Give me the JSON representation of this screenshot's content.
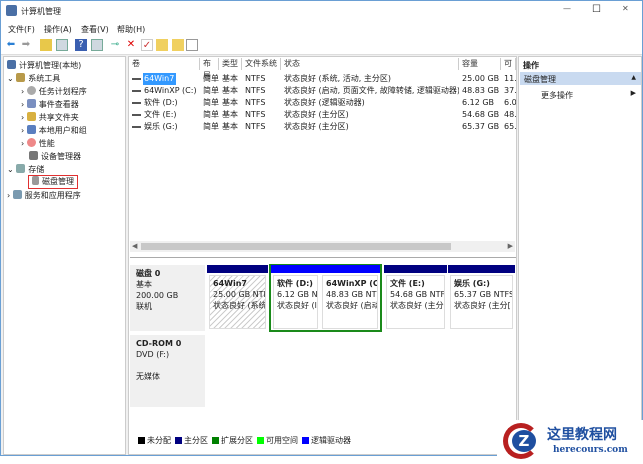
{
  "window": {
    "title": "计算机管理",
    "min": "—",
    "max": "☐",
    "close": "✕"
  },
  "menu": [
    "文件(F)",
    "操作(A)",
    "查看(V)",
    "帮助(H)"
  ],
  "tree": {
    "root": "计算机管理(本地)",
    "system_tools": "系统工具",
    "task_scheduler": "任务计划程序",
    "event_viewer": "事件查看器",
    "shared_folders": "共享文件夹",
    "local_users": "本地用户和组",
    "performance": "性能",
    "device_manager": "设备管理器",
    "storage": "存储",
    "disk_management": "磁盘管理",
    "services": "服务和应用程序"
  },
  "volumes": {
    "headers": [
      "卷",
      "布局",
      "类型",
      "文件系统",
      "状态",
      "容量",
      "可用"
    ],
    "rows": [
      {
        "name": "64Win7",
        "layout": "简单",
        "type": "基本",
        "fs": "NTFS",
        "status": "状态良好 (系统, 活动, 主分区)",
        "capacity": "25.00 GB",
        "free": "11."
      },
      {
        "name": "64WinXP  (C:)",
        "layout": "简单",
        "type": "基本",
        "fs": "NTFS",
        "status": "状态良好 (启动, 页面文件, 故障转储, 逻辑驱动器)",
        "capacity": "48.83 GB",
        "free": "37."
      },
      {
        "name": "软件 (D:)",
        "layout": "简单",
        "type": "基本",
        "fs": "NTFS",
        "status": "状态良好 (逻辑驱动器)",
        "capacity": "6.12 GB",
        "free": "6.0"
      },
      {
        "name": "文件 (E:)",
        "layout": "简单",
        "type": "基本",
        "fs": "NTFS",
        "status": "状态良好 (主分区)",
        "capacity": "54.68 GB",
        "free": "48."
      },
      {
        "name": "娱乐 (G:)",
        "layout": "简单",
        "type": "基本",
        "fs": "NTFS",
        "status": "状态良好 (主分区)",
        "capacity": "65.37 GB",
        "free": "65."
      }
    ]
  },
  "disk0": {
    "name": "磁盘 0",
    "type": "基本",
    "size": "200.00 GB",
    "state": "联机",
    "partitions": [
      {
        "name": "64Win7",
        "size": "25.00 GB NTF",
        "status": "状态良好 (系统"
      },
      {
        "name": "软件  (D:)",
        "size": "6.12 GB N",
        "status": "状态良好 (l"
      },
      {
        "name": "64WinXP   (C",
        "size": "48.83 GB NTF",
        "status": "状态良好 (启动"
      },
      {
        "name": "文件  (E:)",
        "size": "54.68 GB NTFS",
        "status": "状态良好 (主分["
      },
      {
        "name": "娱乐  (G:)",
        "size": "65.37 GB NTFS",
        "status": "状态良好 (主分["
      }
    ]
  },
  "cdrom": {
    "name": "CD-ROM 0",
    "drive": "DVD (F:)",
    "media": "无媒体"
  },
  "legend": [
    {
      "label": "未分配",
      "color": "#000000"
    },
    {
      "label": "主分区",
      "color": "#000080"
    },
    {
      "label": "扩展分区",
      "color": "#008000"
    },
    {
      "label": "可用空间",
      "color": "#00ff00"
    },
    {
      "label": "逻辑驱动器",
      "color": "#0000ff"
    }
  ],
  "actions": {
    "header": "操作",
    "section": "磁盘管理",
    "more": "更多操作"
  },
  "watermark": {
    "cn": "这里教程网",
    "en": "herecours.com"
  }
}
